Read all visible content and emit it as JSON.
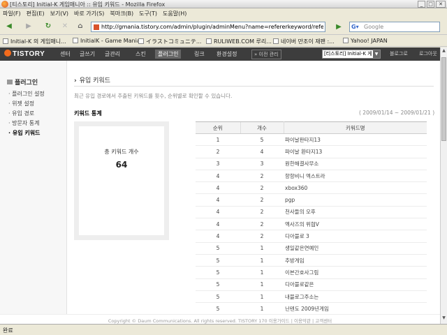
{
  "window": {
    "title": "[티스토리] Initial-K 게임매니아 :: 유입 키워드 - Mozilla Firefox"
  },
  "menu": [
    "파일(F)",
    "편집(E)",
    "보기(V)",
    "바로 가기(S)",
    "북마크(B)",
    "도구(T)",
    "도움말(H)"
  ],
  "nav": {
    "url": "http://gmania.tistory.com/admin/plugin/adminMenu?name=refererkeyword/refererkeywor",
    "search_placeholder": "Google"
  },
  "bookmarks": [
    "Initial-K 의 게임매니...",
    "InitialK - Game Mania",
    "イラストコミュニテ...",
    "RULIWEB.COM 루리...",
    "네이버 만조이 재팬 :...",
    "Yahoo! JAPAN"
  ],
  "tistory": {
    "logo": "TISTORY",
    "menu": [
      "센터",
      "글쓰기",
      "글관리",
      "스킨",
      "플러그인",
      "링크",
      "환경설정"
    ],
    "active_menu": "플러그인",
    "old_admin": "» 이전 관리",
    "blog_select": "[티스토리] Initial-K 게",
    "blog_link": "블로그로",
    "logout": "로그아웃"
  },
  "sidebar": {
    "heading": "플러그인",
    "items": [
      "플러그인 설정",
      "위젯 설정",
      "유입 경로",
      "방문자 통계",
      "유입 키워드"
    ]
  },
  "main": {
    "title": "유입 키워드",
    "description": "최근 유입 경로에서 추출된 키워드를 횟수, 순위별로 확인할 수 있습니다.",
    "section_title": "키워드 통계",
    "date_range": "( 2009/01/14 ~ 2009/01/21 )",
    "total_label": "총 키워드 개수",
    "total_value": "64",
    "columns": [
      "순위",
      "개수",
      "키워드명"
    ],
    "rows": [
      [
        "1",
        "5",
        "파이날판타지13"
      ],
      [
        "2",
        "4",
        "파이날 환타지13"
      ],
      [
        "3",
        "3",
        "원한해결사무소"
      ],
      [
        "4",
        "2",
        "항항비니 엑스트라"
      ],
      [
        "4",
        "2",
        "xbox360"
      ],
      [
        "4",
        "2",
        "pgp"
      ],
      [
        "4",
        "2",
        "천사들의 오후"
      ],
      [
        "4",
        "2",
        "엑사즈의 위협V"
      ],
      [
        "4",
        "2",
        "디아블로 3"
      ],
      [
        "5",
        "1",
        "생일같은연예인"
      ],
      [
        "5",
        "1",
        "추방게임"
      ],
      [
        "5",
        "1",
        "이븐간호사그림"
      ],
      [
        "5",
        "1",
        "디아블로같은"
      ],
      [
        "5",
        "1",
        "내블로그주소는"
      ],
      [
        "5",
        "1",
        "닌텐도 2009년게임"
      ]
    ]
  },
  "footer": "Copyright © Daum Communications. All rights reserved. TISTORY 170  이용가이드 | 이용약관 | 고객센터",
  "status": "완료"
}
